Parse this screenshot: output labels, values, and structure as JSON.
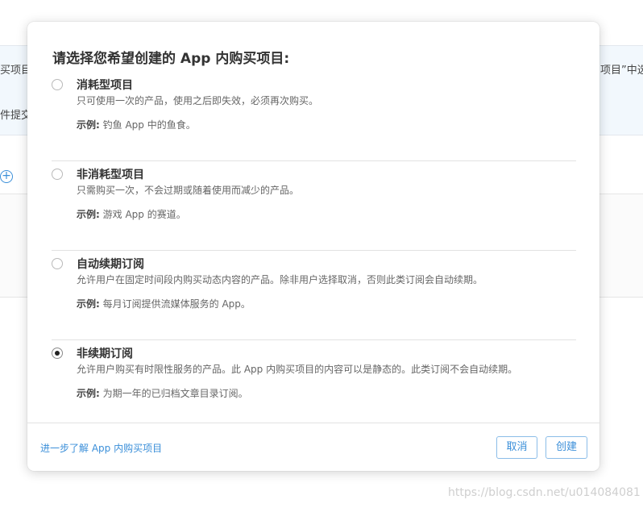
{
  "background": {
    "band_left_line1": "买项目",
    "band_left_line2": "件提交",
    "band_right_line1": "项目”中选"
  },
  "watermark": "https://blog.csdn.net/u014084081",
  "modal": {
    "title": "请选择您希望创建的 App 内购买项目:",
    "options": [
      {
        "title": "消耗型项目",
        "description": "只可使用一次的产品，使用之后即失效，必须再次购买。",
        "example_label": "示例:",
        "example_text": "钓鱼 App 中的鱼食。",
        "selected": false
      },
      {
        "title": "非消耗型项目",
        "description": "只需购买一次，不会过期或随着使用而减少的产品。",
        "example_label": "示例:",
        "example_text": "游戏 App 的赛道。",
        "selected": false
      },
      {
        "title": "自动续期订阅",
        "description": "允许用户在固定时间段内购买动态内容的产品。除非用户选择取消，否则此类订阅会自动续期。",
        "example_label": "示例:",
        "example_text": "每月订阅提供流媒体服务的 App。",
        "selected": false
      },
      {
        "title": "非续期订阅",
        "description": "允许用户购买有时限性服务的产品。此 App 内购买项目的内容可以是静态的。此类订阅不会自动续期。",
        "example_label": "示例:",
        "example_text": "为期一年的已归档文章目录订阅。",
        "selected": true
      }
    ],
    "footer": {
      "learn_more": "进一步了解 App 内购买项目",
      "cancel_label": "取消",
      "create_label": "创建"
    }
  },
  "colors": {
    "accent": "#3b8fd9",
    "band_background": "#f2f8fd"
  }
}
